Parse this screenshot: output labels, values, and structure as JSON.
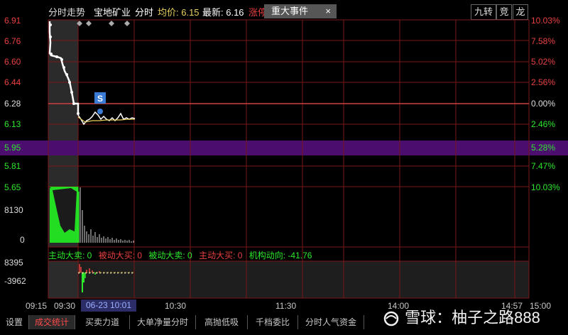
{
  "header": {
    "tab": "分时走势",
    "stock": "宝地矿业",
    "mode": "分时",
    "avg_label": "均价: 6.15",
    "last_label": "最新: 6.16",
    "change_label": "涨停",
    "event_chip": "重大事件",
    "close_glyph": "×",
    "btn_jiuzhuan": "九转",
    "btn_jing": "竞",
    "btn_long": "龙"
  },
  "price_axis": {
    "left": [
      "6.91",
      "6.76",
      "6.60",
      "6.44",
      "6.28",
      "6.13",
      "5.95",
      "5.81",
      "5.65"
    ],
    "right": [
      "10.03%",
      "7.58%",
      "5.02%",
      "2.56%",
      "0.00%",
      "2.46%",
      "5.28%",
      "7.47%",
      "10.03%"
    ]
  },
  "volume_axis": {
    "top": "8130",
    "bottom": "0"
  },
  "flow_axis": {
    "top": "8395",
    "bottom": "-3962"
  },
  "flow_legend": {
    "item1": "主动大卖: 0",
    "item2": "被动大买: 0",
    "item3": "被动大卖: 0",
    "item4": "主动大买: 0",
    "item5": "机构动向: -41.76"
  },
  "signal_marker": "S",
  "time_axis": {
    "t0915": "09:15",
    "t0930": "09:30",
    "cursor": "06-23 10:01",
    "t1030": "10:30",
    "t1130": "11:30",
    "t1400": "14:00",
    "t1457": "14:57",
    "t1500": "15:00"
  },
  "bottom_tabs": [
    "设置",
    "成交统计",
    "买卖力道",
    "大单净量分时",
    "高抛低吸",
    "千档委比",
    "分时人气资金"
  ],
  "watermark": "雪球：柚子之路888",
  "colors": {
    "price_line": "#ffffff",
    "avg_line": "#e8d060",
    "grid": "#8b1a1a",
    "highlight": "#4b0d6e",
    "volume_up": "#2ee82e"
  }
}
